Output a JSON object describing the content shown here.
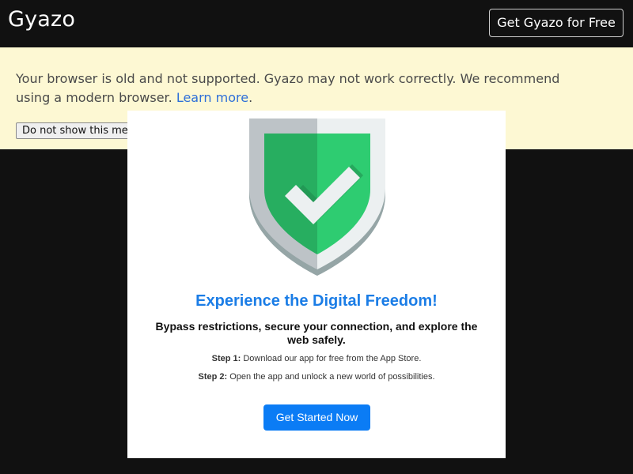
{
  "header": {
    "logo_text": "Gyazo",
    "get_free_label": "Get Gyazo for Free"
  },
  "banner": {
    "message": "Your browser is old and not supported. Gyazo may not work correctly. We recommend using a modern browser.",
    "link_text": "Learn more",
    "link_suffix": ".",
    "dismiss_label": "Do not show this message again"
  },
  "modal": {
    "icon": "shield-check-icon",
    "title": "Experience the Digital Freedom!",
    "subtitle": "Bypass restrictions, secure your connection, and explore the web safely.",
    "steps": [
      {
        "label": "Step 1:",
        "text": "Download our app for free from the App Store."
      },
      {
        "label": "Step 2:",
        "text": "Open the app and unlock a new world of possibilities."
      }
    ],
    "cta_label": "Get Started Now"
  },
  "colors": {
    "background": "#111111",
    "banner_bg": "#fdf8d3",
    "title_blue": "#1b7de6",
    "cta_blue": "#0b7cf5",
    "shield_green_light": "#2ecc71",
    "shield_green_dark": "#27ae60"
  }
}
